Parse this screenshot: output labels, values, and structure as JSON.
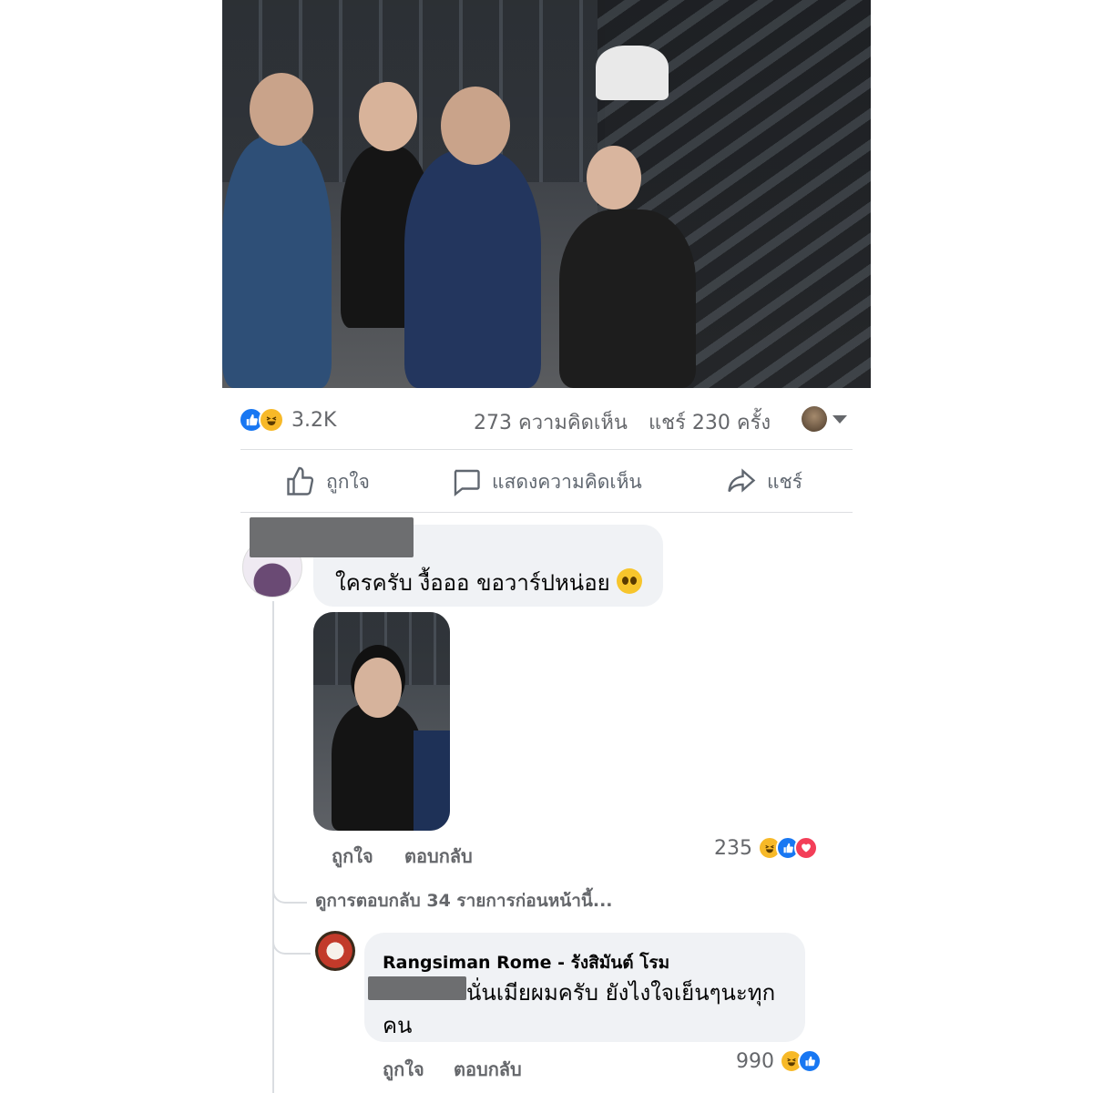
{
  "post": {
    "reactions": {
      "icons": [
        "like-icon",
        "haha-icon"
      ],
      "count": "3.2K"
    },
    "comment_count": "273 ความคิดเห็น",
    "share_count": "แชร์ 230 ครั้ง",
    "actions": {
      "like": "ถูกใจ",
      "comment": "แสดงความคิดเห็น",
      "share": "แชร์"
    }
  },
  "comments": [
    {
      "author_redacted": true,
      "text": "ใครครับ งื้อออ ขอวาร์ปหน่อย",
      "emoji": "pleading-face-emoji",
      "like_label": "ถูกใจ",
      "reply_label": "ตอบกลับ",
      "reaction_count": "235",
      "reaction_icons": [
        "haha-icon",
        "like-icon",
        "love-icon"
      ]
    }
  ],
  "view_previous_replies": "ดูการตอบกลับ 34 รายการก่อนหน้านี้...",
  "reply": {
    "author": "Rangsiman Rome - รังสิมันต์ โรม",
    "text_line1": "นั่นเมียผมครับ ยังไงใจเย็นๆนะทุก",
    "text_line2": "คน",
    "like_label": "ถูกใจ",
    "reply_label": "ตอบกลับ",
    "reaction_count": "990",
    "reaction_icons": [
      "haha-icon",
      "like-icon"
    ]
  },
  "colors": {
    "facebook_blue": "#1877f2",
    "haha_yellow": "#f7b928",
    "love_red": "#f33e58",
    "muted_text": "#65676b",
    "bubble_bg": "#f0f2f5"
  }
}
